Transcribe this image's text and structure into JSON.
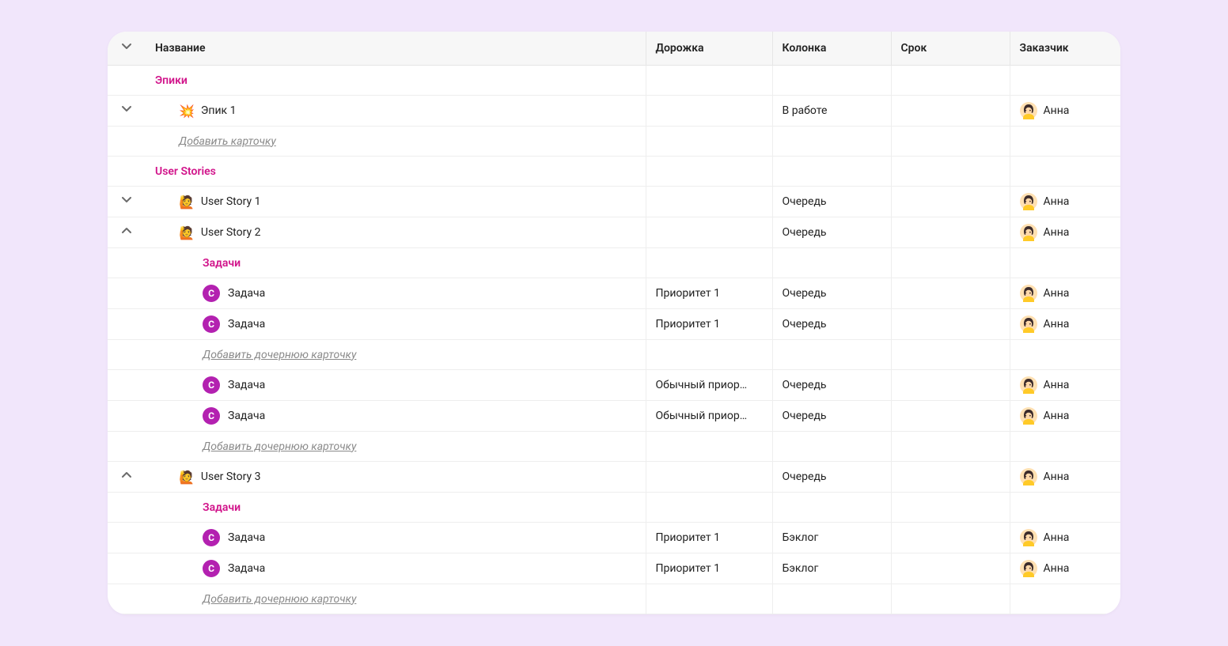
{
  "columns": {
    "name": "Название",
    "track": "Дорожка",
    "column": "Колонка",
    "due": "Срок",
    "owner": "Заказчик"
  },
  "labels": {
    "add_card": "Добавить карточку",
    "add_child_card": "Добавить дочернюю карточку"
  },
  "sections": {
    "epics": "Эпики",
    "user_stories": "User Stories",
    "tasks": "Задачи"
  },
  "icons": {
    "collision": "💥",
    "raising_hand": "🙋",
    "tag_letter": "С"
  },
  "owner": {
    "name": "Анна"
  },
  "rows": {
    "epic1": {
      "title": "Эпик 1",
      "column": "В работе"
    },
    "user_story_1": {
      "title": "User Story 1",
      "column": "Очередь"
    },
    "user_story_2": {
      "title": "User Story 2",
      "column": "Очередь"
    },
    "user_story_3": {
      "title": "User Story 3",
      "column": "Очередь"
    },
    "task_p1_q_1": {
      "title": "Задача",
      "track": "Приоритет 1",
      "column": "Очередь"
    },
    "task_p1_q_2": {
      "title": "Задача",
      "track": "Приоритет 1",
      "column": "Очередь"
    },
    "task_np_q_1": {
      "title": "Задача",
      "track": "Обычный приор…",
      "column": "Очередь"
    },
    "task_np_q_2": {
      "title": "Задача",
      "track": "Обычный приор…",
      "column": "Очередь"
    },
    "task_p1_b_1": {
      "title": "Задача",
      "track": "Приоритет 1",
      "column": "Бэклог"
    },
    "task_p1_b_2": {
      "title": "Задача",
      "track": "Приоритет 1",
      "column": "Бэклог"
    }
  }
}
